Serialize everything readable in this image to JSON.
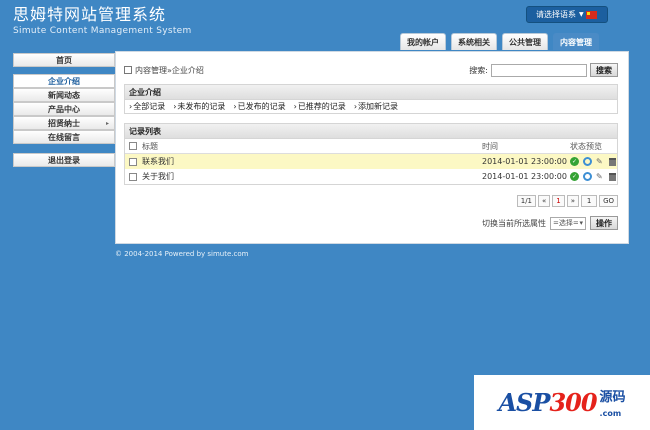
{
  "brand": {
    "title_cn": "思姆特网站管理系统",
    "title_en": "Simute Content Management System"
  },
  "lang": {
    "label": "请选择语系",
    "flag": "china-flag"
  },
  "tabs": [
    {
      "label": "我的帐户"
    },
    {
      "label": "系统相关"
    },
    {
      "label": "公共管理"
    },
    {
      "label": "内容管理"
    }
  ],
  "sidebar": {
    "items": [
      {
        "label": "首页"
      },
      {
        "label": "企业介绍"
      },
      {
        "label": "新闻动态"
      },
      {
        "label": "产品中心"
      },
      {
        "label": "招贤纳士"
      },
      {
        "label": "在线留言"
      },
      {
        "label": "退出登录"
      }
    ]
  },
  "breadcrumb": {
    "root": "内容管理",
    "sep": " » ",
    "current": "企业介绍"
  },
  "search": {
    "label": "搜索:",
    "placeholder": "",
    "button": "搜索"
  },
  "section1": {
    "title": "企业介绍",
    "links": [
      "全部记录",
      "未发布的记录",
      "已发布的记录",
      "已推荐的记录",
      "添加新记录"
    ]
  },
  "section2": {
    "title": "记录列表",
    "columns": {
      "title": "标题",
      "time": "时间",
      "status": "状态",
      "preview": "预览"
    },
    "rows": [
      {
        "title": "联系我们",
        "time": "2014-01-01 23:00:00"
      },
      {
        "title": "关于我们",
        "time": "2014-01-01 23:00:00"
      }
    ]
  },
  "pager": {
    "total": "1/1",
    "prev": "«",
    "current": "1",
    "next": "»",
    "page_input": "1",
    "go": "GO"
  },
  "batch": {
    "label": "切换当前所选属性",
    "select": "=选择=",
    "button": "操作"
  },
  "footer": {
    "text": "© 2004-2014 Powered by simute.com"
  },
  "watermark": {
    "text_a": "ASP",
    "text_b": "300",
    "text_c": "源码",
    "site": ".com"
  },
  "colors": {
    "background": "#3f87c4",
    "active_tab": "#4a8bc6",
    "highlight_row": "#fcf8c4"
  }
}
